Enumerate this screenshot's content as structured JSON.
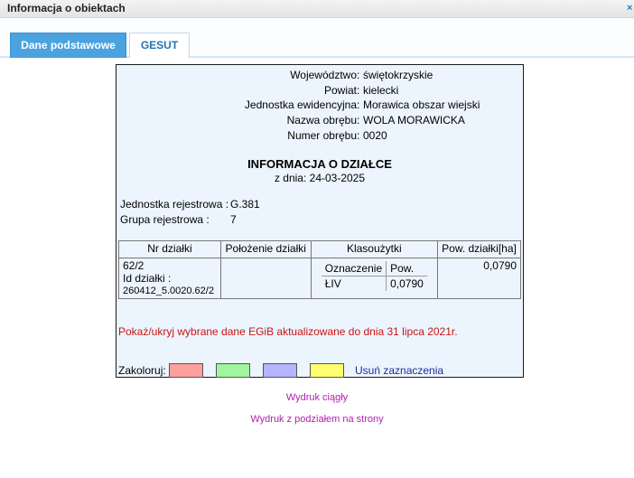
{
  "window": {
    "title": "Informacja o obiektach",
    "close_symbol": "×"
  },
  "tabs": [
    {
      "label": "Dane podstawowe",
      "active": true
    },
    {
      "label": "GESUT",
      "active": false
    }
  ],
  "admin": [
    {
      "label": "Województwo",
      "value": "świętokrzyskie"
    },
    {
      "label": "Powiat",
      "value": "kielecki"
    },
    {
      "label": "Jednostka ewidencyjna",
      "value": "Morawica obszar wiejski"
    },
    {
      "label": "Nazwa obrębu",
      "value": "WOLA MORAWICKA"
    },
    {
      "label": "Numer obrębu",
      "value": "0020"
    }
  ],
  "info": {
    "heading": "INFORMACJA O DZIAŁCE",
    "date_line": "z dnia: 24-03-2025"
  },
  "registry": {
    "jednostka_label": "Jednostka rejestrowa :",
    "jednostka_value": "G.381",
    "grupa_label": "Grupa rejestrowa :",
    "grupa_value": "7"
  },
  "parcel_table": {
    "headers": [
      "Nr działki",
      "Położenie działki",
      "Klasoużytki",
      "Pow. działki[ha]"
    ],
    "nr": "62/2",
    "id_label": "Id działki :",
    "id_value": "260412_5.0020.62/2",
    "polozenie": "",
    "klas_headers": [
      "Oznaczenie",
      "Pow."
    ],
    "klas_row": [
      "ŁIV",
      "0,0790"
    ],
    "pow": "0,0790"
  },
  "toggle_text": "Pokaż/ukryj wybrane dane EGiB aktualizowane do dnia 31 lipca 2021r.",
  "colorize": {
    "label": "Zakoloruj:",
    "swatches": [
      "#ffa0a0",
      "#a0f5a0",
      "#b4b4ff",
      "#ffff70"
    ],
    "clear_label": "Usuń zaznaczenia"
  },
  "links": {
    "print_continuous": "Wydruk ciągły",
    "print_paged": "Wydruk z podziałem na strony"
  }
}
